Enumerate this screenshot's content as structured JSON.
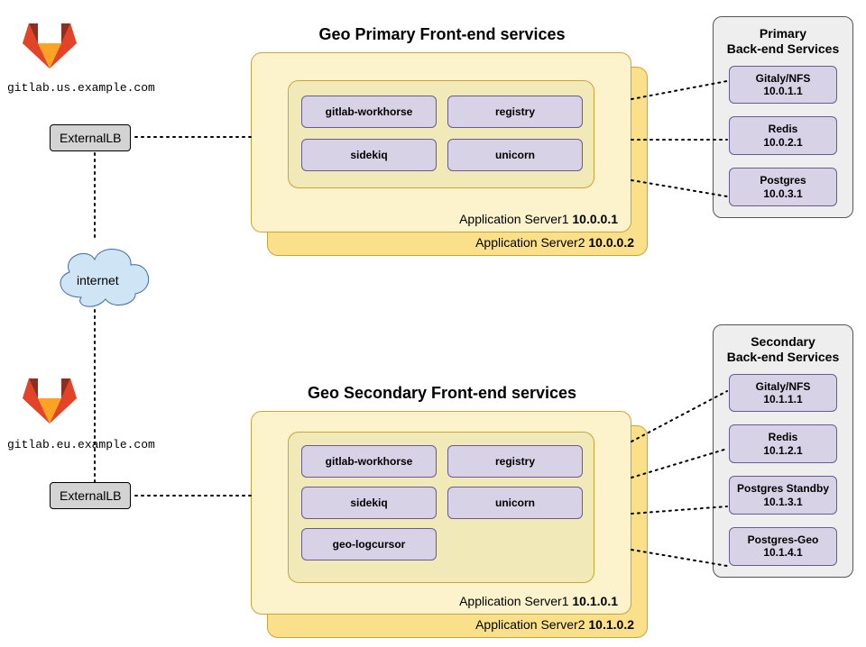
{
  "primary": {
    "title": "Geo Primary Front-end services",
    "domain": "gitlab.us.example.com",
    "lb": "ExternalLB",
    "services": {
      "workhorse": "gitlab-workhorse",
      "registry": "registry",
      "sidekiq": "sidekiq",
      "unicorn": "unicorn"
    },
    "app1_label": "Application Server1",
    "app1_ip": "10.0.0.1",
    "app2_label": "Application Server2",
    "app2_ip": "10.0.0.2",
    "backend": {
      "title_l1": "Primary",
      "title_l2": "Back-end Services",
      "gitaly": {
        "name": "Gitaly/NFS",
        "ip": "10.0.1.1"
      },
      "redis": {
        "name": "Redis",
        "ip": "10.0.2.1"
      },
      "pg": {
        "name": "Postgres",
        "ip": "10.0.3.1"
      }
    }
  },
  "internet": "internet",
  "secondary": {
    "title": "Geo Secondary Front-end services",
    "domain": "gitlab.eu.example.com",
    "lb": "ExternalLB",
    "services": {
      "workhorse": "gitlab-workhorse",
      "registry": "registry",
      "sidekiq": "sidekiq",
      "unicorn": "unicorn",
      "geolog": "geo-logcursor"
    },
    "app1_label": "Application Server1",
    "app1_ip": "10.1.0.1",
    "app2_label": "Application Server2",
    "app2_ip": "10.1.0.2",
    "backend": {
      "title_l1": "Secondary",
      "title_l2": "Back-end Services",
      "gitaly": {
        "name": "Gitaly/NFS",
        "ip": "10.1.1.1"
      },
      "redis": {
        "name": "Redis",
        "ip": "10.1.2.1"
      },
      "pgstd": {
        "name": "Postgres Standby",
        "ip": "10.1.3.1"
      },
      "pggeo": {
        "name": "Postgres-Geo",
        "ip": "10.1.4.1"
      }
    }
  }
}
